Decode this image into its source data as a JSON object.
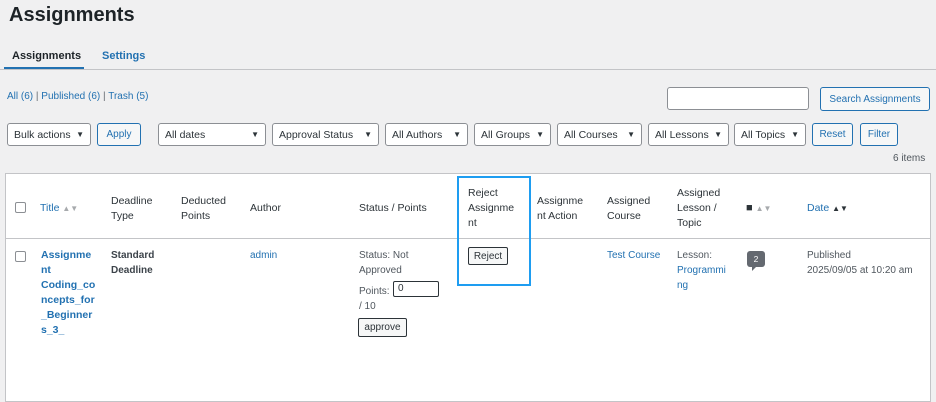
{
  "page": {
    "title": "Assignments"
  },
  "tabs": [
    {
      "label": "Assignments"
    },
    {
      "label": "Settings"
    }
  ],
  "views": {
    "all": "All (6)",
    "published": "Published (6)",
    "trash": "Trash (5)",
    "separator": "|"
  },
  "search": {
    "value": "",
    "button": "Search Assignments"
  },
  "filters": {
    "bulk_actions": "Bulk actions",
    "apply": "Apply",
    "dates": "All dates",
    "approval": "Approval Status",
    "authors": "All Authors",
    "groups": "All Groups",
    "courses": "All Courses",
    "lessons": "All Lessons",
    "topics": "All Topics",
    "reset": "Reset",
    "filter": "Filter"
  },
  "items_count": "6 items",
  "columns": {
    "title": "Title",
    "deadline_type": [
      "Deadline",
      "Type"
    ],
    "deducted_points": [
      "Deducted",
      "Points"
    ],
    "author": "Author",
    "status_points": "Status / Points",
    "reject": [
      "Reject",
      "Assignme",
      "nt"
    ],
    "action": [
      "Assignme",
      "nt Action"
    ],
    "course": [
      "Assigned",
      "Course"
    ],
    "lesson": [
      "Assigned",
      "Lesson /",
      "Topic"
    ],
    "date": "Date"
  },
  "row": {
    "title_lines": [
      "Assignme",
      "nt",
      "Coding_co",
      "ncepts_for",
      "_Beginner",
      "s_3_"
    ],
    "deadline_lines": [
      "Standard",
      "Deadline"
    ],
    "author": "admin",
    "status_lines": [
      "Status: Not",
      "Approved"
    ],
    "points_label": "Points:",
    "points_value": "0",
    "points_total": "/ 10",
    "approve": "approve",
    "reject": "Reject",
    "course": "Test Course",
    "lesson_label": "Lesson:",
    "lesson_lines": [
      "Programmi",
      "ng"
    ],
    "comments": "2",
    "date_lines": [
      "Published",
      "2025/09/05 at 10:20 am"
    ]
  },
  "icons": {
    "sort": "sort-arrows-icon",
    "comment": "comment-bubble-icon",
    "chevron": "chevron-down-icon"
  },
  "colors": {
    "accent": "#2271b1",
    "highlight": "#1e9df1"
  }
}
